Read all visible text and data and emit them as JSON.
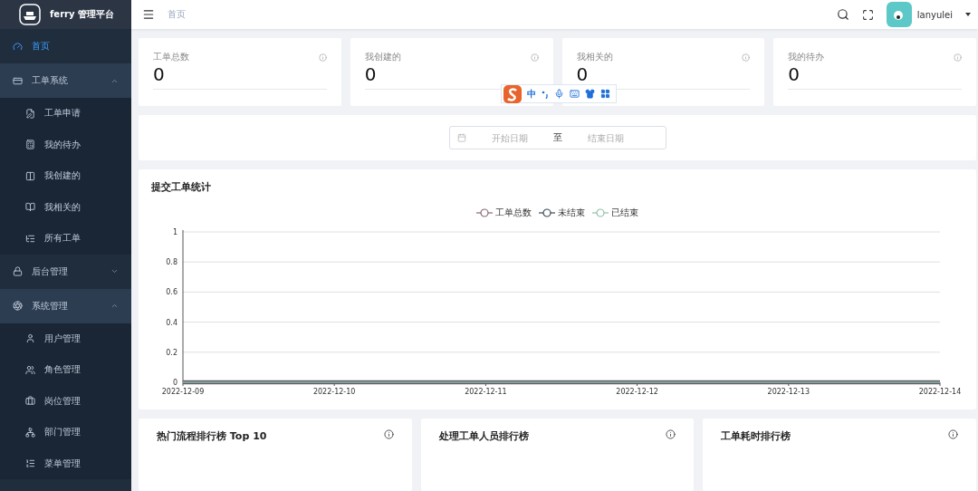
{
  "app": {
    "title": "ferry 管理平台"
  },
  "sidebar": {
    "items": [
      {
        "kind": "link",
        "label": "首页",
        "selected": true
      },
      {
        "kind": "group",
        "label": "工单系统",
        "expanded": true,
        "children": [
          {
            "label": "工单申请",
            "selected": false
          },
          {
            "label": "我的待办",
            "selected": false
          },
          {
            "label": "我创建的",
            "selected": false
          },
          {
            "label": "我相关的",
            "selected": false
          },
          {
            "label": "所有工单",
            "selected": false
          }
        ]
      },
      {
        "kind": "group",
        "label": "后台管理",
        "expanded": false
      },
      {
        "kind": "group",
        "label": "系统管理",
        "expanded": true,
        "children": [
          {
            "label": "用户管理",
            "selected": false
          },
          {
            "label": "角色管理",
            "selected": false
          },
          {
            "label": "岗位管理",
            "selected": false
          },
          {
            "label": "部门管理",
            "selected": false
          },
          {
            "label": "菜单管理",
            "selected": false
          }
        ]
      }
    ]
  },
  "header": {
    "breadcrumb": "首页",
    "username": "lanyulei"
  },
  "stats": [
    {
      "title": "工单总数",
      "value": "0"
    },
    {
      "title": "我创建的",
      "value": "0"
    },
    {
      "title": "我相关的",
      "value": "0"
    },
    {
      "title": "我的待办",
      "value": "0"
    }
  ],
  "date_range": {
    "start_placeholder": "开始日期",
    "separator": "至",
    "end_placeholder": "结束日期"
  },
  "chart_card": {
    "title": "提交工单统计",
    "chart_data": {
      "type": "line",
      "grid": true,
      "categories": [
        "2022-12-09",
        "2022-12-10",
        "2022-12-11",
        "2022-12-12",
        "2022-12-13",
        "2022-12-14"
      ],
      "ylim": [
        0,
        1
      ],
      "yticks": [
        0,
        0.2,
        0.4,
        0.6,
        0.8,
        1
      ],
      "series": [
        {
          "name": "工单总数",
          "color": "#8c6a78",
          "values": [
            0,
            0,
            0,
            0,
            0,
            0
          ]
        },
        {
          "name": "未结束",
          "color": "#3e4a58",
          "values": [
            0,
            0,
            0,
            0,
            0,
            0
          ]
        },
        {
          "name": "已结束",
          "color": "#8fc1aa",
          "values": [
            0,
            0,
            0,
            0,
            0,
            0
          ]
        }
      ]
    }
  },
  "rank_cards": [
    {
      "title": "热门流程排行榜 Top 10"
    },
    {
      "title": "处理工单人员排行榜"
    },
    {
      "title": "工单耗时排行榜"
    }
  ],
  "ime_toolbar": {
    "label": "中"
  }
}
